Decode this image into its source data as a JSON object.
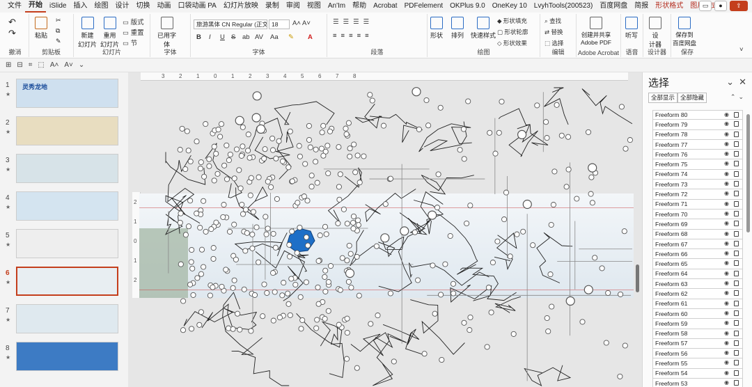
{
  "menu": {
    "tabs": [
      "文件",
      "开始",
      "iSlide",
      "插入",
      "绘图",
      "设计",
      "切换",
      "动画",
      "口袋动画 PA",
      "幻灯片放映",
      "录制",
      "审阅",
      "视图",
      "An'Im",
      "帮助",
      "Acrobat",
      "PDFelement",
      "OKPlus 9.0",
      "OneKey 10",
      "LvyhTools(200523)",
      "百度网盘",
      "简报"
    ],
    "context_tabs": [
      "形状格式",
      "图片格式"
    ],
    "active": "开始"
  },
  "ribbon": {
    "undo_label": "撤消",
    "clipboard": {
      "paste": "粘贴",
      "label": "剪贴板"
    },
    "slides": {
      "new_slide": "新建\n幻灯片",
      "reuse": "重用\n幻灯片",
      "layout": "版式",
      "reset": "重置",
      "section": "节",
      "label": "幻灯片"
    },
    "font_group_small": {
      "label": "字体",
      "used_fonts": "已用字\n体"
    },
    "font": {
      "name": "旅游黑体 CN Regular (正文)",
      "size": "18",
      "label": "字体",
      "buttons": [
        "B",
        "I",
        "U",
        "S",
        "ab",
        "AV",
        "Aa",
        "A",
        "A"
      ]
    },
    "paragraph": {
      "label": "段落"
    },
    "drawing": {
      "shape": "形状",
      "arrange": "排列",
      "quick_styles": "快速样式",
      "fill": "形状填充",
      "outline": "形状轮廓",
      "effects": "形状效果",
      "label": "绘图"
    },
    "editing": {
      "find": "查找",
      "replace": "替换",
      "select": "选择",
      "label": "编辑"
    },
    "acrobat": {
      "create_share": "创建并共享\nAdobe PDF",
      "label": "Adobe Acrobat"
    },
    "voice": {
      "dictate": "听写",
      "label": "语音"
    },
    "designer": {
      "btn": "设\n计器",
      "label": "设计器"
    },
    "save": {
      "btn": "保存到\n百度网盘",
      "label": "保存"
    }
  },
  "thumbnails": [
    {
      "num": "1",
      "title": "灵秀龙地",
      "sel": false,
      "bg": "#cfe0ef"
    },
    {
      "num": "2",
      "title": "",
      "sel": false,
      "bg": "#e8ddc0"
    },
    {
      "num": "3",
      "title": "",
      "sel": false,
      "bg": "#d7e3e8"
    },
    {
      "num": "4",
      "title": "",
      "sel": false,
      "bg": "#d4e4f0"
    },
    {
      "num": "5",
      "title": "",
      "sel": false,
      "bg": "#eeeeee"
    },
    {
      "num": "6",
      "title": "",
      "sel": true,
      "bg": "#e8eef2"
    },
    {
      "num": "7",
      "title": "",
      "sel": false,
      "bg": "#dfe9ef"
    },
    {
      "num": "8",
      "title": "",
      "sel": false,
      "bg": "#3d7bc4"
    }
  ],
  "ruler": {
    "h": [
      "3",
      "2",
      "1",
      "0",
      "1",
      "2",
      "3",
      "4",
      "5",
      "6",
      "7",
      "8"
    ],
    "v": [
      "2",
      "1",
      "0",
      "1",
      "2"
    ]
  },
  "selection_pane": {
    "title": "选择",
    "show_all": "全部显示",
    "hide_all": "全部隐藏",
    "items": [
      "Freeform 80",
      "Freeform 79",
      "Freeform 78",
      "Freeform 77",
      "Freeform 76",
      "Freeform 75",
      "Freeform 74",
      "Freeform 73",
      "Freeform 72",
      "Freeform 71",
      "Freeform 70",
      "Freeform 69",
      "Freeform 68",
      "Freeform 67",
      "Freeform 66",
      "Freeform 65",
      "Freeform 64",
      "Freeform 63",
      "Freeform 62",
      "Freeform 61",
      "Freeform 60",
      "Freeform 59",
      "Freeform 58",
      "Freeform 57",
      "Freeform 56",
      "Freeform 55",
      "Freeform 54",
      "Freeform 53"
    ]
  },
  "colors": {
    "accent": "#c43e1c",
    "highlight_region": "#1e6fc7"
  }
}
